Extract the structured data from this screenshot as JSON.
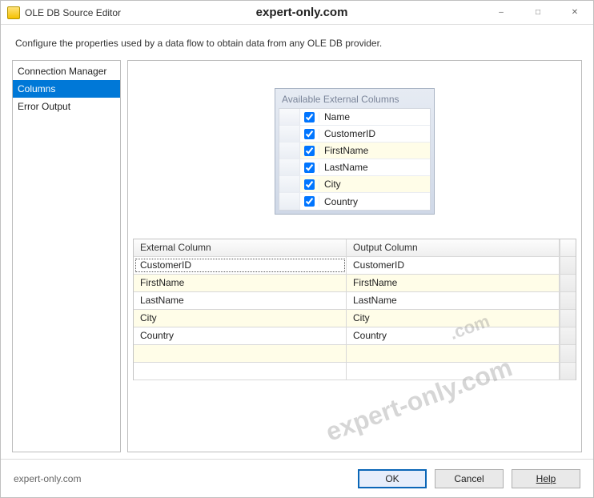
{
  "window": {
    "title": "OLE DB Source Editor",
    "watermark": "expert-only.com"
  },
  "instruction": "Configure the properties used by a data flow to obtain data from any OLE DB provider.",
  "nav": {
    "items": [
      {
        "label": "Connection Manager",
        "selected": false
      },
      {
        "label": "Columns",
        "selected": true
      },
      {
        "label": "Error Output",
        "selected": false
      }
    ]
  },
  "available": {
    "title": "Available External Columns",
    "header": "Name",
    "columns": [
      {
        "name": "CustomerID",
        "checked": true,
        "alt": false
      },
      {
        "name": "FirstName",
        "checked": true,
        "alt": true
      },
      {
        "name": "LastName",
        "checked": true,
        "alt": false
      },
      {
        "name": "City",
        "checked": true,
        "alt": true
      },
      {
        "name": "Country",
        "checked": true,
        "alt": false
      }
    ],
    "selectAllChecked": true
  },
  "mapping": {
    "headers": {
      "external": "External Column",
      "output": "Output Column"
    },
    "rows": [
      {
        "external": "CustomerID",
        "output": "CustomerID",
        "alt": false,
        "focus": true
      },
      {
        "external": "FirstName",
        "output": "FirstName",
        "alt": true,
        "focus": false
      },
      {
        "external": "LastName",
        "output": "LastName",
        "alt": false,
        "focus": false
      },
      {
        "external": "City",
        "output": "City",
        "alt": true,
        "focus": false
      },
      {
        "external": "Country",
        "output": "Country",
        "alt": false,
        "focus": false
      }
    ],
    "blankAltRows": 2
  },
  "buttons": {
    "ok": "OK",
    "cancel": "Cancel",
    "help": "Help"
  },
  "footer_watermark": "expert-only.com"
}
